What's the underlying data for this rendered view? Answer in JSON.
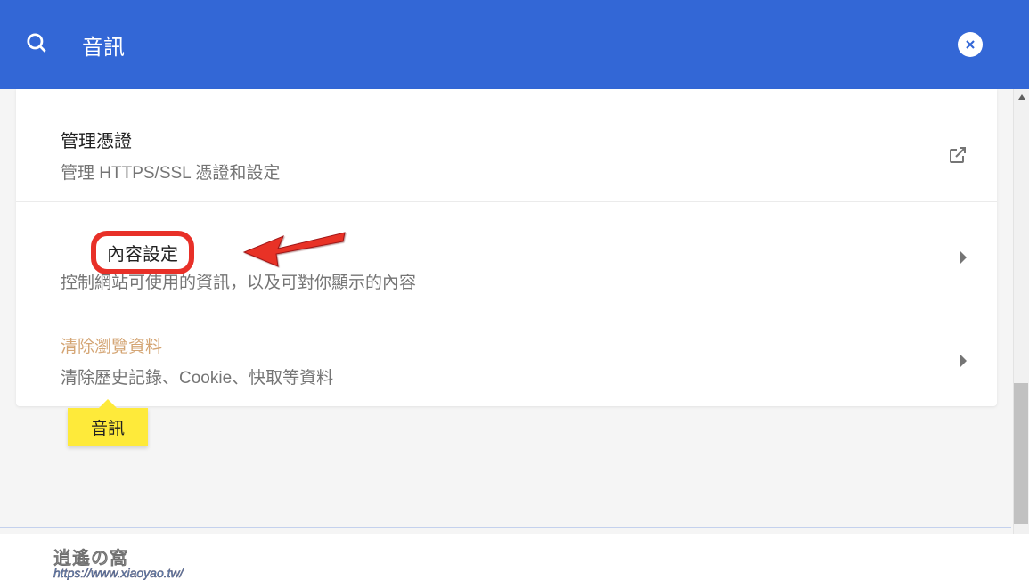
{
  "search": {
    "value": "音訊",
    "placeholder": ""
  },
  "rows": [
    {
      "title": "管理憑證",
      "subtitle": "管理 HTTPS/SSL 憑證和設定",
      "action_icon": "open-external-icon"
    },
    {
      "title": "內容設定",
      "subtitle": "控制網站可使用的資訊，以及可對你顯示的內容",
      "action_icon": "chevron-right-icon"
    },
    {
      "title": "清除瀏覽資料",
      "subtitle": "清除歷史記錄、Cookie、快取等資料",
      "action_icon": "chevron-right-icon"
    }
  ],
  "tooltip": "音訊",
  "watermark": {
    "line1": "逍遙の窩",
    "line2": "https://www.xiaoyao.tw/"
  },
  "colors": {
    "header": "#3367d6",
    "highlight_border": "#e83028",
    "tooltip_bg": "#feea3a"
  }
}
